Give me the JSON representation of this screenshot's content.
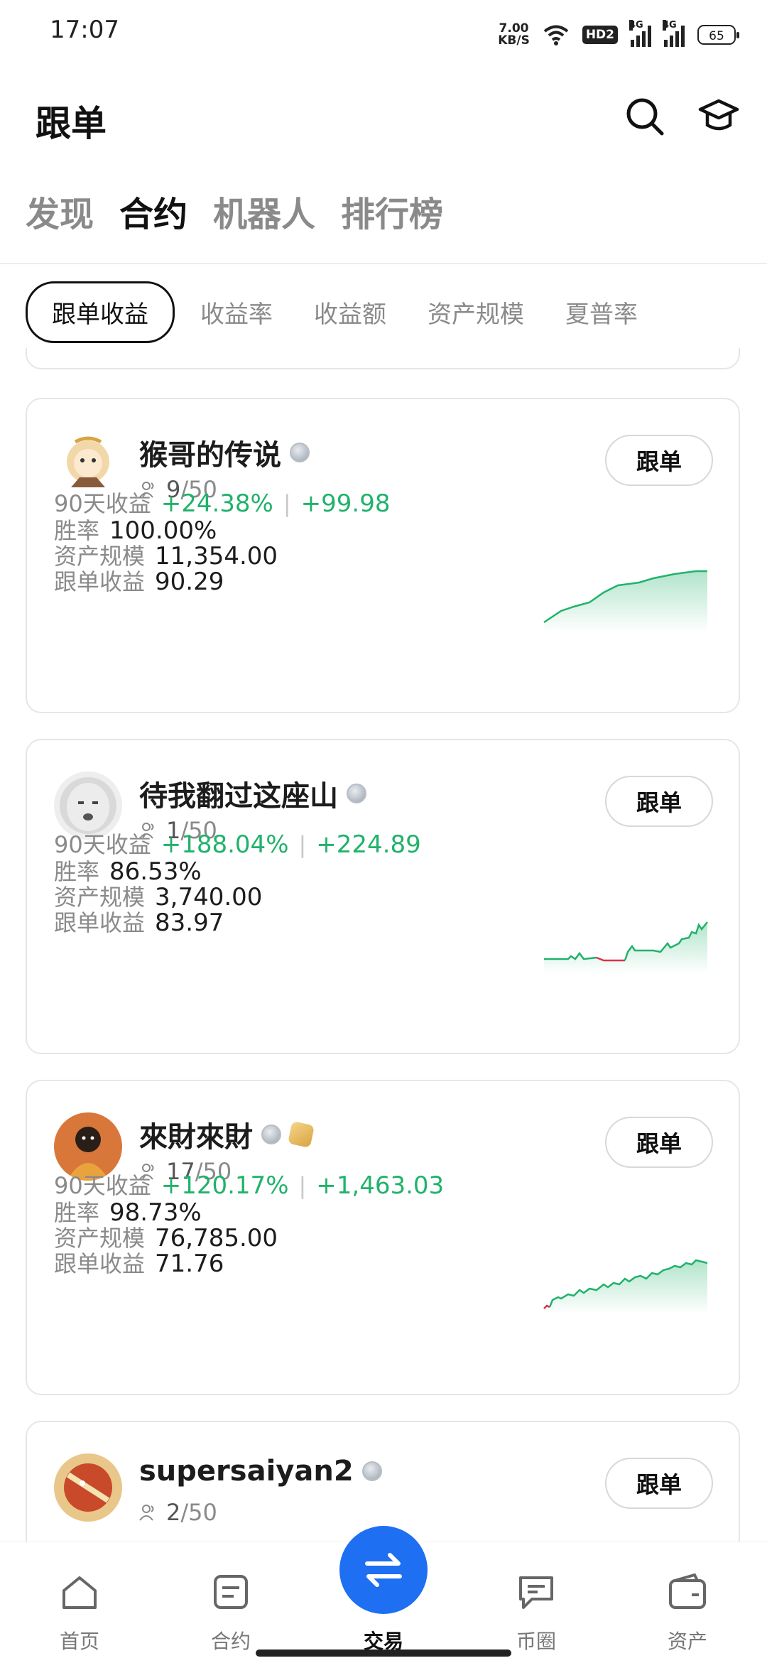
{
  "status_bar": {
    "time": "17:07",
    "net_speed_value": "7.00",
    "net_speed_unit": "KB/S",
    "hd_label": "HD2",
    "signal_1_label": "4G",
    "signal_2_label": "4G",
    "battery": "65"
  },
  "header": {
    "title": "跟单",
    "search_icon": "search-icon",
    "learn_icon": "graduation-cap-icon"
  },
  "top_tabs": [
    {
      "label": "发现",
      "active": false
    },
    {
      "label": "合约",
      "active": true
    },
    {
      "label": "机器人",
      "active": false
    },
    {
      "label": "排行榜",
      "active": false
    }
  ],
  "sort_chips": [
    {
      "label": "跟单收益",
      "active": true
    },
    {
      "label": "收益率",
      "active": false
    },
    {
      "label": "收益额",
      "active": false
    },
    {
      "label": "资产规模",
      "active": false
    },
    {
      "label": "夏普率",
      "active": false
    }
  ],
  "labels": {
    "ret90": "90天收益",
    "win_rate": "胜率",
    "aum": "资产规模",
    "follow_profit": "跟单收益",
    "follow_button": "跟单",
    "separator": "|"
  },
  "traders": [
    {
      "name": "猴哥的传说",
      "followers": "9",
      "max_followers": "/50",
      "ret90_pct": "+24.38%",
      "ret90_amount": "+99.98",
      "win_rate": "100.00%",
      "aum": "11,354.00",
      "follow_profit": "90.29",
      "has_gold_badge": false
    },
    {
      "name": "待我翻过这座山",
      "followers": "1",
      "max_followers": "/50",
      "ret90_pct": "+188.04%",
      "ret90_amount": "+224.89",
      "win_rate": "86.53%",
      "aum": "3,740.00",
      "follow_profit": "83.97",
      "has_gold_badge": false
    },
    {
      "name": "來財來財",
      "followers": "17",
      "max_followers": "/50",
      "ret90_pct": "+120.17%",
      "ret90_amount": "+1,463.03",
      "win_rate": "98.73%",
      "aum": "76,785.00",
      "follow_profit": "71.76",
      "has_gold_badge": true
    },
    {
      "name": "supersaiyan2",
      "followers": "2",
      "max_followers": "/50",
      "has_gold_badge": false
    }
  ],
  "bottom_nav": [
    {
      "label": "首页",
      "icon": "home-icon"
    },
    {
      "label": "合约",
      "icon": "contract-icon"
    },
    {
      "label": "交易",
      "icon": "swap-icon"
    },
    {
      "label": "币圈",
      "icon": "chat-icon"
    },
    {
      "label": "资产",
      "icon": "wallet-icon"
    }
  ],
  "colors": {
    "positive": "#21b26b",
    "negative": "#e0304a",
    "accent": "#1f6ff2"
  }
}
